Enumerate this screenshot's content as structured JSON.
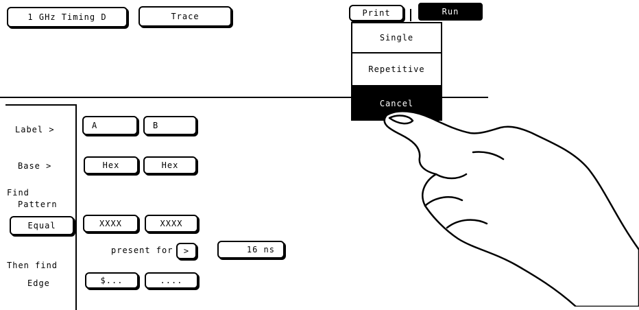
{
  "header": {
    "analyzer_label": "1 GHz Timing D",
    "trace_label": "Trace",
    "print_label": "Print",
    "run_label": "Run"
  },
  "run_menu": {
    "items": [
      "Single",
      "Repetitive",
      "Cancel"
    ]
  },
  "trace_spec": {
    "label_row": {
      "caption": "Label >",
      "values": [
        "A",
        "B"
      ]
    },
    "base_row": {
      "caption": "Base >",
      "values": [
        "Hex",
        "Hex"
      ]
    },
    "find_pattern": {
      "caption_line1": "Find",
      "caption_line2": "Pattern",
      "mode": "Equal",
      "values": [
        "XXXX",
        "XXXX"
      ]
    },
    "present_for": {
      "text": "present for",
      "operator": ">",
      "duration": "16 ns"
    },
    "then_find_edge": {
      "caption_line1": "Then find",
      "caption_line2": "Edge",
      "values": [
        "$...",
        "...."
      ]
    }
  },
  "colors": {
    "ink": "#000000",
    "paper": "#ffffff"
  }
}
